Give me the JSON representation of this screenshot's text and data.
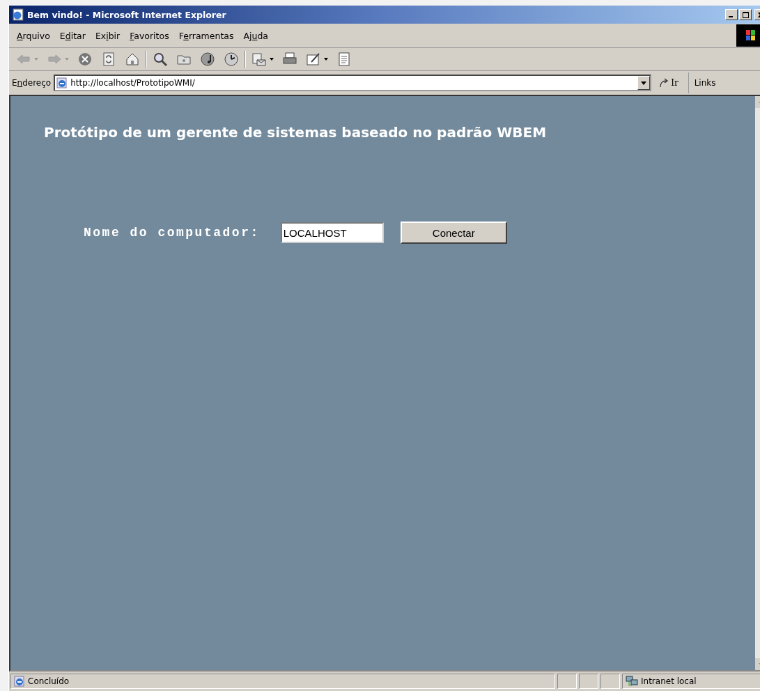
{
  "window": {
    "title": "Bem vindo! - Microsoft Internet Explorer"
  },
  "menu": [
    {
      "underlined": "A",
      "after": "rquivo"
    },
    {
      "before": "E",
      "underlined": "d",
      "after": "itar"
    },
    {
      "before": "Ex",
      "underlined": "i",
      "after": "bir"
    },
    {
      "underlined": "F",
      "after": "avoritos"
    },
    {
      "before": "F",
      "underlined": "e",
      "after": "rramentas"
    },
    {
      "before": "Aj",
      "underlined": "u",
      "after": "da"
    }
  ],
  "address_bar": {
    "label": {
      "before": "E",
      "underlined": "n",
      "after": "dereço"
    },
    "value": "http://localhost/PrototipoWMI/",
    "go_button": "Ir",
    "links": "Links"
  },
  "page": {
    "heading": "Protótipo de um gerente de sistemas baseado no padrão WBEM",
    "field_label": "Nome do computador:",
    "field_value": "LOCALHOST",
    "button": "Conectar"
  },
  "status_bar": {
    "status": "Concluído",
    "zone": "Intranet local"
  }
}
